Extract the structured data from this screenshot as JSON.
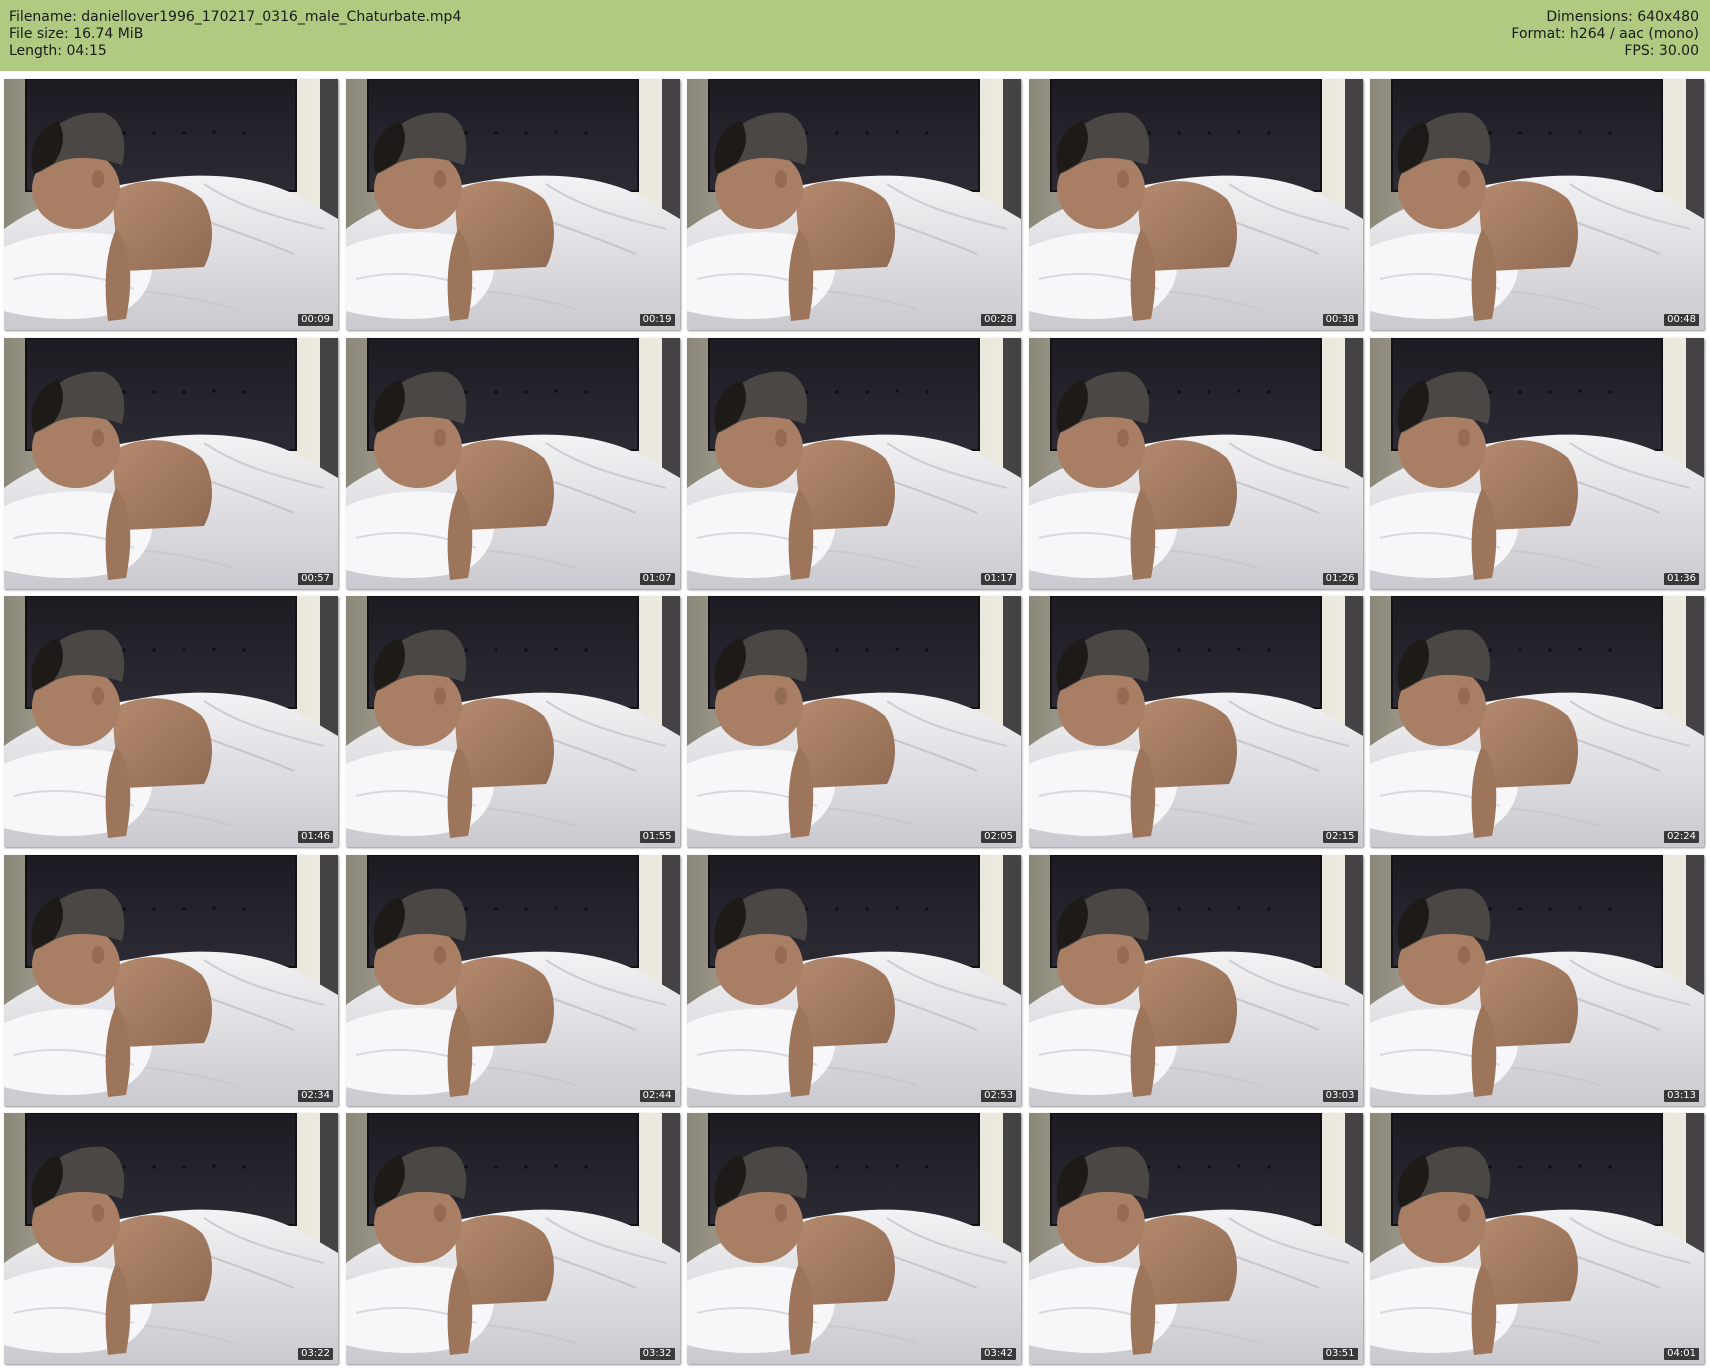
{
  "header": {
    "filename_line": "Filename: daniellover1996_170217_0316_male_Chaturbate.mp4",
    "filesize_line": "File size: 16.74 MiB",
    "length_line": "Length: 04:15",
    "dimensions_line": "Dimensions: 640x480",
    "format_line": "Format: h264 / aac (mono)",
    "fps_line": "FPS: 30.00"
  },
  "colors": {
    "header_bg": "#b0cb81",
    "page_bg": "#ffffff",
    "timestamp_bg": "#000000",
    "timestamp_text": "#ffffff"
  },
  "thumbnails": [
    {
      "time": "00:09"
    },
    {
      "time": "00:19"
    },
    {
      "time": "00:28"
    },
    {
      "time": "00:38"
    },
    {
      "time": "00:48"
    },
    {
      "time": "00:57"
    },
    {
      "time": "01:07"
    },
    {
      "time": "01:17"
    },
    {
      "time": "01:26"
    },
    {
      "time": "01:36"
    },
    {
      "time": "01:46"
    },
    {
      "time": "01:55"
    },
    {
      "time": "02:05"
    },
    {
      "time": "02:15"
    },
    {
      "time": "02:24"
    },
    {
      "time": "02:34"
    },
    {
      "time": "02:44"
    },
    {
      "time": "02:53"
    },
    {
      "time": "03:03"
    },
    {
      "time": "03:13"
    },
    {
      "time": "03:22"
    },
    {
      "time": "03:32"
    },
    {
      "time": "03:42"
    },
    {
      "time": "03:51"
    },
    {
      "time": "04:01"
    }
  ]
}
